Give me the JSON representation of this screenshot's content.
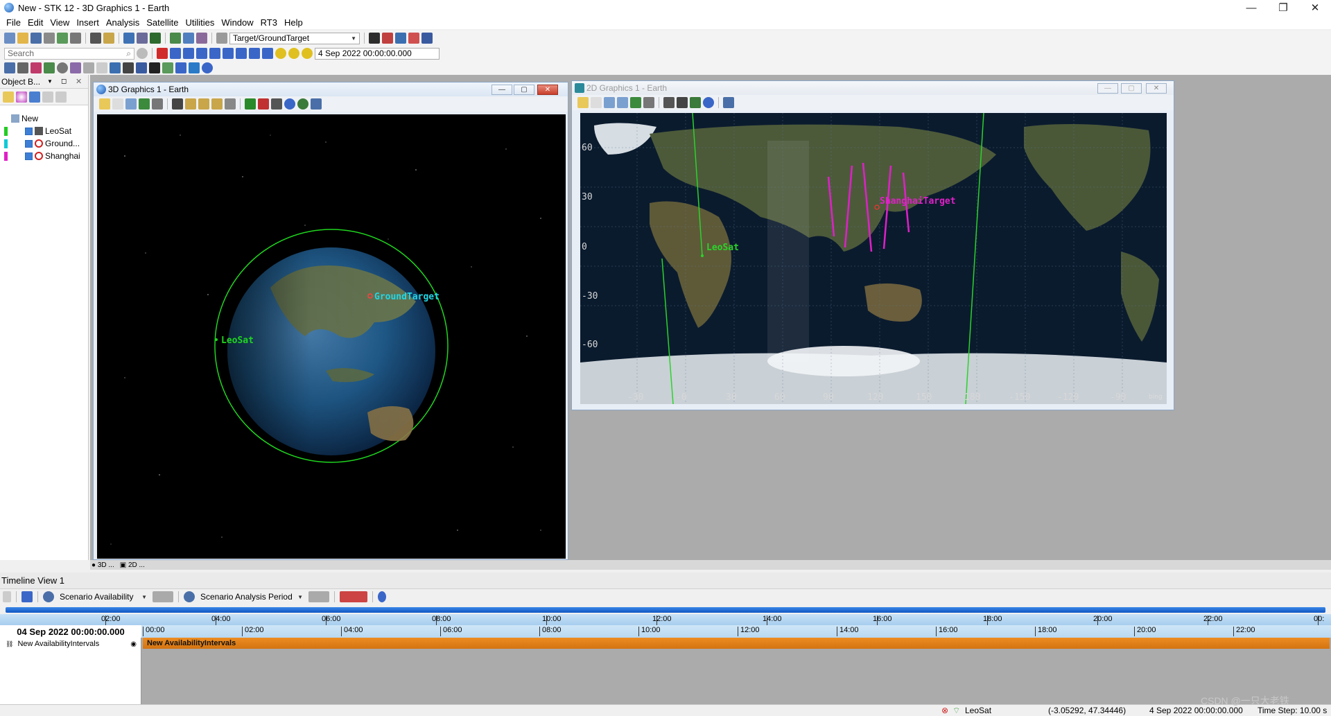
{
  "window": {
    "title": "New - STK 12 - 3D Graphics 1 - Earth",
    "minimize": "—",
    "maximize": "❐",
    "close": "✕"
  },
  "menu": [
    "File",
    "Edit",
    "View",
    "Insert",
    "Analysis",
    "Satellite",
    "Utilities",
    "Window",
    "RT3",
    "Help"
  ],
  "toolbar": {
    "target_combo": "Target/GroundTarget",
    "search_placeholder": "Search",
    "current_time": "4 Sep 2022 00:00:00.000"
  },
  "object_browser": {
    "title": "Object B...",
    "root": "New",
    "items": [
      {
        "label": "LeoSat",
        "color": "#22cc22"
      },
      {
        "label": "Ground...",
        "color": "#11c9d6"
      },
      {
        "label": "Shanghai",
        "color": "#e020c8"
      }
    ]
  },
  "view3d": {
    "title": "3D Graphics 1 - Earth",
    "labels": {
      "target": "GroundTarget",
      "satellite": "LeoSat"
    }
  },
  "view2d": {
    "title": "2D Graphics 1 - Earth",
    "labels": {
      "target": "ShanghaiTarget",
      "satellite": "LeoSat"
    },
    "lat_ticks": [
      "60",
      "30",
      "0",
      "-30",
      "-60"
    ],
    "lon_ticks": [
      "-30",
      "-0",
      "30",
      "60",
      "90",
      "120",
      "150",
      "180",
      "-150",
      "-120",
      "-90"
    ],
    "attribution": "bing"
  },
  "window_tabs": [
    "3D ...",
    "2D ..."
  ],
  "timeline": {
    "title": "Timeline View 1",
    "availability_combo": "Scenario Availability",
    "period_combo": "Scenario Analysis Period",
    "date": "04 Sep 2022 00:00:00.000",
    "top_ticks": [
      "02:00",
      "04:00",
      "06:00",
      "08:00",
      "10:00",
      "12:00",
      "14:00",
      "16:00",
      "18:00",
      "20:00",
      "22:00",
      "00:"
    ],
    "bottom_ticks": [
      "00:00",
      "02:00",
      "04:00",
      "06:00",
      "08:00",
      "10:00",
      "12:00",
      "14:00",
      "16:00",
      "18:00",
      "20:00",
      "22:00"
    ],
    "row_label": "New AvailabilityIntervals",
    "interval_label": "New AvailabilityIntervals"
  },
  "status": {
    "object": "LeoSat",
    "coords": "(-3.05292, 47.34446)",
    "time": "4 Sep 2022 00:00:00.000",
    "timestep": "Time Step: 10.00 s",
    "watermark": "CSDN @一只大老铁"
  }
}
